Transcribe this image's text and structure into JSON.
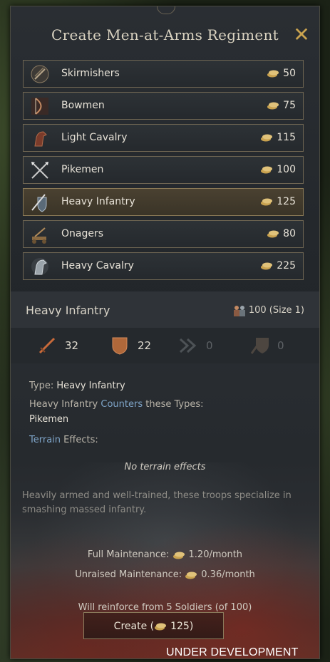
{
  "window": {
    "title": "Create Men-at-Arms Regiment",
    "close_icon": "close-icon",
    "accent_color": "#c9a24f"
  },
  "regiments": [
    {
      "name": "Skirmishers",
      "cost": "50",
      "icon": "skirmisher-icon"
    },
    {
      "name": "Bowmen",
      "cost": "75",
      "icon": "bow-icon"
    },
    {
      "name": "Light Cavalry",
      "cost": "115",
      "icon": "horse-icon"
    },
    {
      "name": "Pikemen",
      "cost": "100",
      "icon": "crossed-pikes-icon"
    },
    {
      "name": "Heavy Infantry",
      "cost": "125",
      "icon": "sword-shield-icon",
      "selected": true
    },
    {
      "name": "Onagers",
      "cost": "80",
      "icon": "siege-icon"
    },
    {
      "name": "Heavy Cavalry",
      "cost": "225",
      "icon": "armored-horse-icon"
    }
  ],
  "detail": {
    "name": "Heavy Infantry",
    "size": "100 (Size 1)",
    "stats": {
      "damage": "32",
      "toughness": "22",
      "pursuit": "0",
      "screen": "0"
    },
    "type_label": "Type:",
    "type_value": "Heavy Infantry",
    "counters_prefix": "Heavy Infantry",
    "counters_link": "Counters",
    "counters_suffix": "these Types:",
    "counters_value": "Pikemen",
    "terrain_link": "Terrain",
    "terrain_suffix": "Effects:",
    "terrain_none": "No terrain effects",
    "description": "Heavily armed and well-trained, these troops specialize in smashing massed infantry.",
    "full_maint_label": "Full Maintenance:",
    "full_maint_value": "1.20/month",
    "unraised_maint_label": "Unraised Maintenance:",
    "unraised_maint_value": "0.36/month",
    "reinforce": "Will reinforce from 5 Soldiers (of 100)",
    "create_label_prefix": "Create (",
    "create_cost": "125",
    "create_label_suffix": ")"
  },
  "overlay": {
    "watermark": "UNDER DEVELOPMENT"
  }
}
